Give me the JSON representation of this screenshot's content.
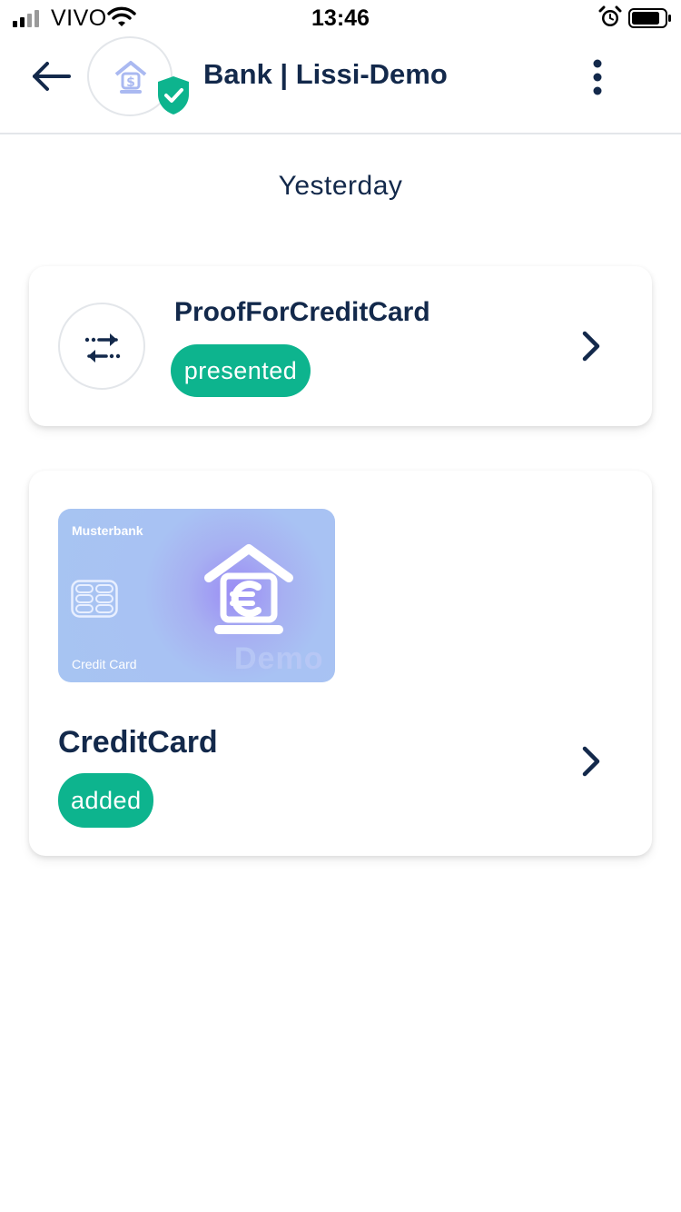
{
  "status_bar": {
    "carrier": "VIVO",
    "time": "13:46"
  },
  "header": {
    "title": "Bank | Lissi-Demo",
    "verified": true
  },
  "section": {
    "label": "Yesterday"
  },
  "items": [
    {
      "title": "ProofForCreditCard",
      "status": "presented",
      "icon": "exchange-arrows-icon"
    },
    {
      "title": "CreditCard",
      "status": "added",
      "card": {
        "bank": "Musterbank",
        "type": "Credit Card",
        "watermark": "Demo"
      }
    }
  ],
  "colors": {
    "primary_text": "#13294b",
    "status_green": "#0db48e",
    "card_blue": "#a7c4f2"
  }
}
